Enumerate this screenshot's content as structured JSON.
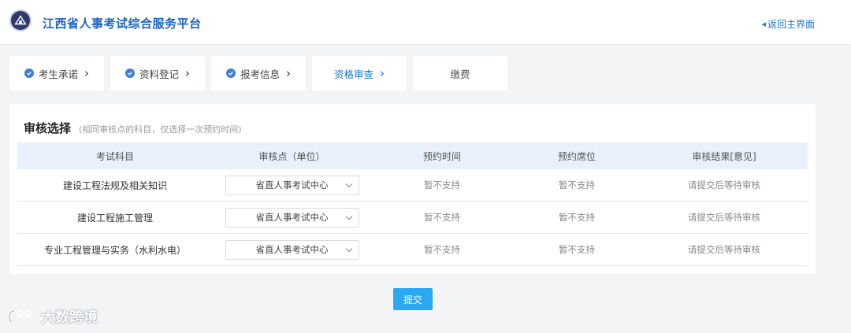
{
  "header": {
    "site_title": "江西省人事考试综合服务平台",
    "back_label": "返回主界面"
  },
  "steps": [
    {
      "label": "考生承诺",
      "state": "done"
    },
    {
      "label": "资料登记",
      "state": "done"
    },
    {
      "label": "报考信息",
      "state": "done"
    },
    {
      "label": "资格审查",
      "state": "active"
    },
    {
      "label": "缴费",
      "state": "pending"
    }
  ],
  "section": {
    "title": "审核选择",
    "hint": "(相同审核点的科目，仅选择一次预约时间)"
  },
  "table": {
    "headers": [
      "考试科目",
      "审核点（单位）",
      "预约时间",
      "预约席位",
      "审核结果[意见]"
    ],
    "rows": [
      {
        "subject": "建设工程法规及相关知识",
        "site": "省直人事考试中心",
        "time": "暂不支持",
        "seat": "暂不支持",
        "result": "请提交后等待审核"
      },
      {
        "subject": "建设工程施工管理",
        "site": "省直人事考试中心",
        "time": "暂不支持",
        "seat": "暂不支持",
        "result": "请提交后等待审核"
      },
      {
        "subject": "专业工程管理与实务（水利水电）",
        "site": "省直人事考试中心",
        "time": "暂不支持",
        "seat": "暂不支持",
        "result": "请提交后等待审核"
      }
    ]
  },
  "submit_label": "提交",
  "watermark": "大数跨境",
  "colors": {
    "brand": "#1b63c7",
    "accent": "#2aa8f2",
    "table_header_bg": "#e8f1fb"
  }
}
